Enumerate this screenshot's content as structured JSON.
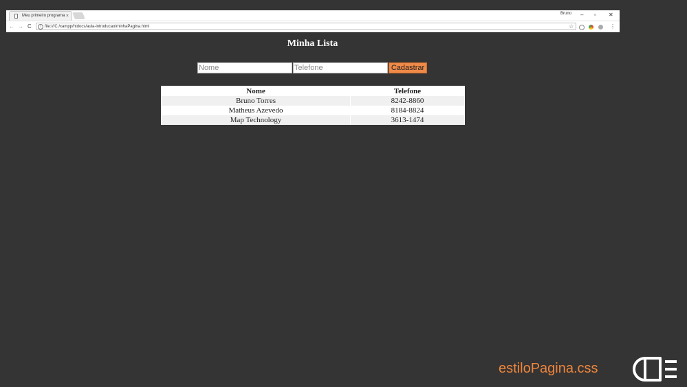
{
  "browser": {
    "tab_title": "Meu primeiro programa",
    "tab_close": "×",
    "user_label": "Bruno",
    "window_controls": {
      "minimize": "–",
      "restore": "▫",
      "close": "✕"
    },
    "nav": {
      "back": "←",
      "forward": "→",
      "reload": "C"
    },
    "url": "file:///C:/xampp/htdocs/aula-introducao/minhaPagina.html",
    "info_icon": "i",
    "extensions": {
      "star": "☆",
      "menu": "⋮"
    }
  },
  "page": {
    "title": "Minha Lista",
    "form": {
      "nome_placeholder": "Nome",
      "telefone_placeholder": "Telefone",
      "submit_label": "Cadastrar"
    },
    "table": {
      "headers": [
        "Nome",
        "Telefone"
      ],
      "rows": [
        [
          "Bruno Torres",
          "8242-8860"
        ],
        [
          "Matheus Azevedo",
          "8184-8824"
        ],
        [
          "Map Technology",
          "3613-1474"
        ]
      ]
    }
  },
  "footer": {
    "filename": "estiloPagina.css",
    "accent": "#f0853b"
  },
  "colors": {
    "background": "#343434",
    "button": "#f08a48",
    "row_alt": "#f0f0f0"
  }
}
